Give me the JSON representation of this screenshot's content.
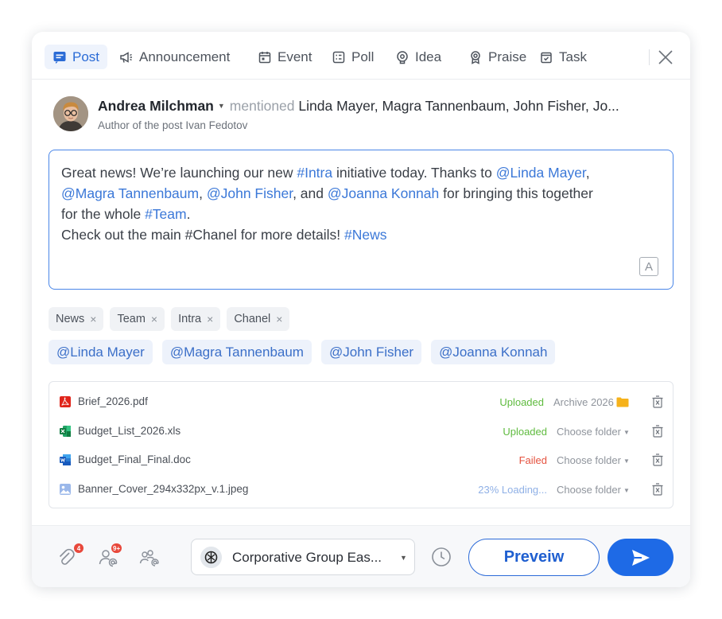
{
  "tabs": [
    {
      "label": "Post",
      "icon": "post-icon",
      "active": true
    },
    {
      "label": "Announcement",
      "icon": "megaphone-icon"
    },
    {
      "label": "Event",
      "icon": "calendar-icon"
    },
    {
      "label": "Poll",
      "icon": "poll-icon"
    },
    {
      "label": "Idea",
      "icon": "idea-icon"
    },
    {
      "label": "Praise",
      "icon": "badge-icon"
    },
    {
      "label": "Task",
      "icon": "task-icon"
    }
  ],
  "author": {
    "name": "Andrea Milchman",
    "mentioned_label": "mentioned",
    "mentioned_names": "Linda Mayer, Magra Tannenbaum, John Fisher, Jo...",
    "subline": "Author of the post Ivan Fedotov"
  },
  "editor": {
    "line1_a": "Great news! We’re launching our new ",
    "line1_tag": "#Intra",
    "line1_b": " initiative today. Thanks to ",
    "line1_m1": "@Linda Mayer",
    "line1_c": ",",
    "line2_m2": "@Magra Tannenbaum",
    "line2_a": ", ",
    "line2_m3": "@John Fisher",
    "line2_b": ", and ",
    "line2_m4": "@Joanna Konnah",
    "line2_c": " for bringing this together",
    "line3_a": "for the whole ",
    "line3_tag": "#Team",
    "line3_b": ".",
    "line4_a": "Check out the main #Chanel for more details! ",
    "line4_tag": "#News",
    "format_label": "A"
  },
  "tags": [
    "News",
    "Team",
    "Intra",
    "Chanel"
  ],
  "tag_remove": "×",
  "mentions": [
    "@Linda Mayer",
    "@Magra Tannenbaum",
    "@John Fisher",
    "@Joanna Konnah"
  ],
  "files": [
    {
      "name": "Brief_2026.pdf",
      "type": "pdf",
      "status": "Uploaded",
      "folder": "Archive 2026"
    },
    {
      "name": "Budget_List_2026.xls",
      "type": "xls",
      "status": "Uploaded",
      "folder": "Choose folder"
    },
    {
      "name": "Budget_Final_Final.doc",
      "type": "doc",
      "status": "Failed",
      "folder": "Choose folder"
    },
    {
      "name": "Banner_Cover_294x332px_v.1.jpeg",
      "type": "image",
      "status": "23% Loading...",
      "folder": "Choose folder"
    }
  ],
  "footer": {
    "attach_badge": "4",
    "mention_badge": "9+",
    "group_name": "Corporative Group Eas...",
    "preview_label": "Preveiw"
  },
  "colors": {
    "accent": "#1e6ae6",
    "uploaded": "#5fbb3f",
    "failed": "#e5523f",
    "loading": "#8fb0e6",
    "badge": "#e8483b"
  }
}
